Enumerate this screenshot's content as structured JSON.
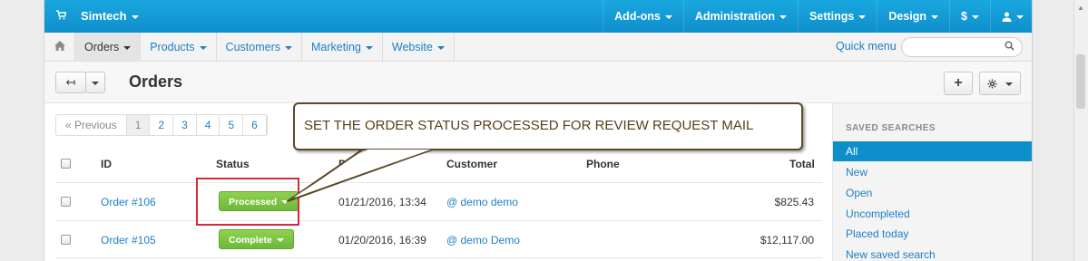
{
  "topbar": {
    "brand": "Simtech",
    "menu": [
      "Add-ons",
      "Administration",
      "Settings",
      "Design",
      "$",
      "user"
    ]
  },
  "nav2": {
    "tabs": [
      "Orders",
      "Products",
      "Customers",
      "Marketing",
      "Website"
    ],
    "quick_menu": "Quick menu"
  },
  "header": {
    "title": "Orders"
  },
  "pager": {
    "prev": "« Previous",
    "pages": [
      "1",
      "2",
      "3",
      "4",
      "5",
      "6"
    ]
  },
  "table": {
    "columns": {
      "id": "ID",
      "status": "Status",
      "date": "D",
      "customer": "Customer",
      "phone": "Phone",
      "total": "Total"
    },
    "rows": [
      {
        "id": "Order #106",
        "status": "Processed",
        "date": "01/21/2016, 13:34",
        "customer": "@ demo demo",
        "total": "$825.43"
      },
      {
        "id": "Order #105",
        "status": "Complete",
        "date": "01/20/2016, 16:39",
        "customer": "@ demo Demo",
        "total": "$12,117.00"
      }
    ]
  },
  "sidebar": {
    "title": "SAVED SEARCHES",
    "items": [
      "All",
      "New",
      "Open",
      "Uncompleted",
      "Placed today",
      "New saved search"
    ]
  },
  "callout": {
    "text": "SET THE ORDER STATUS PROCESSED FOR REVIEW REQUEST MAIL"
  },
  "colors": {
    "topbar": "#0e8fcb",
    "link": "#1d7fc4",
    "status_green": "#6db93a",
    "highlight": "#d8283a"
  }
}
